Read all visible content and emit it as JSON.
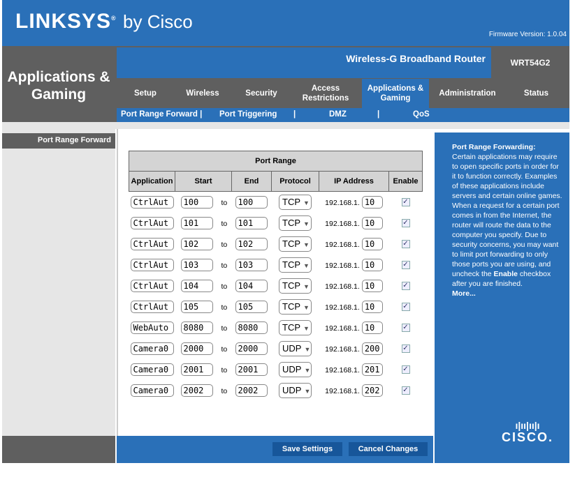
{
  "header": {
    "logo": "LINKSYS",
    "logo_suffix": "by Cisco",
    "firmware": "Firmware Version: 1.0.04",
    "section": "Applications & Gaming",
    "product": "Wireless-G Broadband Router",
    "model": "WRT54G2"
  },
  "tabs": [
    {
      "label": "Setup"
    },
    {
      "label": "Wireless"
    },
    {
      "label": "Security"
    },
    {
      "label": "Access Restrictions"
    },
    {
      "label": "Applications & Gaming",
      "active": true
    },
    {
      "label": "Administration"
    },
    {
      "label": "Status"
    }
  ],
  "subtabs": [
    {
      "label": "Port Range Forward |"
    },
    {
      "label": "Port Triggering"
    },
    {
      "label": "|"
    },
    {
      "label": "DMZ"
    },
    {
      "label": "|"
    },
    {
      "label": "QoS"
    }
  ],
  "left_label": "Port Range Forward",
  "table": {
    "group_header": "Port Range",
    "columns": [
      "Application",
      "Start",
      "End",
      "Protocol",
      "IP Address",
      "Enable"
    ],
    "to": "to",
    "ip_prefix": "192.168.1.",
    "rows": [
      {
        "app": "CtrlAut",
        "start": "100",
        "end": "100",
        "protocol": "TCP",
        "ip": "10",
        "enabled": true
      },
      {
        "app": "CtrlAut",
        "start": "101",
        "end": "101",
        "protocol": "TCP",
        "ip": "10",
        "enabled": true
      },
      {
        "app": "CtrlAut",
        "start": "102",
        "end": "102",
        "protocol": "TCP",
        "ip": "10",
        "enabled": true
      },
      {
        "app": "CtrlAut",
        "start": "103",
        "end": "103",
        "protocol": "TCP",
        "ip": "10",
        "enabled": true
      },
      {
        "app": "CtrlAut",
        "start": "104",
        "end": "104",
        "protocol": "TCP",
        "ip": "10",
        "enabled": true
      },
      {
        "app": "CtrlAut",
        "start": "105",
        "end": "105",
        "protocol": "TCP",
        "ip": "10",
        "enabled": true
      },
      {
        "app": "WebAuto",
        "start": "8080",
        "end": "8080",
        "protocol": "TCP",
        "ip": "10",
        "enabled": true
      },
      {
        "app": "Camera0",
        "start": "2000",
        "end": "2000",
        "protocol": "UDP",
        "ip": "200",
        "enabled": true
      },
      {
        "app": "Camera0",
        "start": "2001",
        "end": "2001",
        "protocol": "UDP",
        "ip": "201",
        "enabled": true
      },
      {
        "app": "Camera0",
        "start": "2002",
        "end": "2002",
        "protocol": "UDP",
        "ip": "202",
        "enabled": true
      }
    ]
  },
  "help": {
    "title": "Port Range Forwarding:",
    "text_before": "Certain applications may require to open specific ports in order for it to function correctly. Examples of these applications include servers and certain online games. When a request for a certain port comes in from the Internet, the router will route the data to the computer you specify. Due to security concerns, you may want to limit port forwarding to only those ports you are using, and uncheck the ",
    "bold": "Enable",
    "text_after": " checkbox after you are finished.",
    "more": "More..."
  },
  "footer": {
    "save": "Save Settings",
    "cancel": "Cancel Changes",
    "brand": "CISCO."
  },
  "colors": {
    "blue": "#2a70b8",
    "gray": "#5f5f5f",
    "button": "#17569a"
  }
}
